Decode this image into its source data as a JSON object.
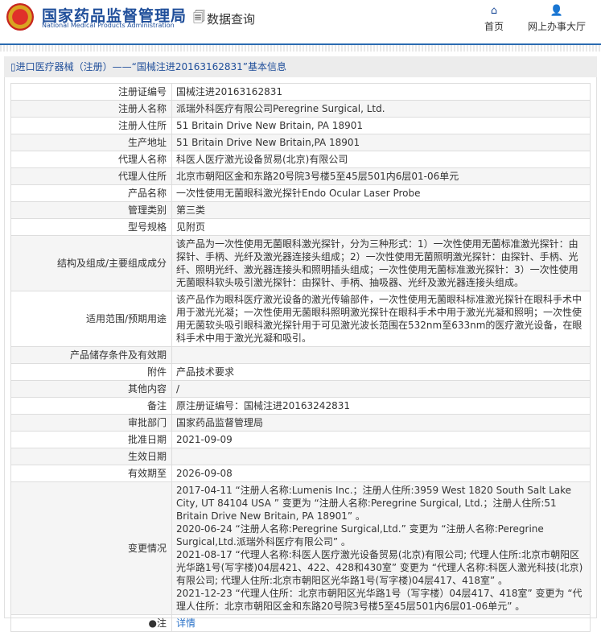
{
  "header": {
    "logo_cn": "国家药品监督管理局",
    "logo_en": "National Medical Products Administration",
    "data_query": "数据查询",
    "nav": [
      {
        "label": "首页",
        "icon": "home-icon"
      },
      {
        "label": "网上办事大厅",
        "icon": "user-icon"
      }
    ]
  },
  "breadcrumb": "进口医疗器械（注册）——“国械注进20163162831”基本信息",
  "rows": [
    {
      "label": "注册证编号",
      "value": "国械注进20163162831"
    },
    {
      "label": "注册人名称",
      "value": "派瑞外科医疗有限公司Peregrine Surgical, Ltd."
    },
    {
      "label": "注册人住所",
      "value": "51 Britain Drive New Britain, PA 18901"
    },
    {
      "label": "生产地址",
      "value": "51 Britain Drive New Britain,PA 18901"
    },
    {
      "label": "代理人名称",
      "value": "科医人医疗激光设备贸易(北京)有限公司"
    },
    {
      "label": "代理人住所",
      "value": "北京市朝阳区金和东路20号院3号楼5至45层501内6层01-06单元"
    },
    {
      "label": "产品名称",
      "value": "一次性使用无菌眼科激光探针Endo Ocular Laser Probe"
    },
    {
      "label": "管理类别",
      "value": "第三类"
    },
    {
      "label": "型号规格",
      "value": "见附页"
    },
    {
      "label": "结构及组成/主要组成成分",
      "value": "该产品为一次性使用无菌眼科激光探针，分为三种形式：1）一次性使用无菌标准激光探针：由探针、手柄、光纤及激光器连接头组成；2）一次性使用无菌照明激光探针：由探针、手柄、光纤、照明光纤、激光器连接头和照明插头组成；一次性使用无菌标准激光探针：3）一次性使用无菌眼科软头吸引激光探针：由探针、手柄、抽吸器、光纤及激光器连接头组成。"
    },
    {
      "label": "适用范围/预期用途",
      "value": "该产品作为眼科医疗激光设备的激光传输部件，一次性使用无菌眼科标准激光探针在眼科手术中用于激光光凝；一次性使用无菌眼科照明激光探针在眼科手术中用于激光光凝和照明；一次性使用无菌软头吸引眼科激光探针用于可见激光波长范围在532nm至633nm的医疗激光设备，在眼科手术中用于激光光凝和吸引。"
    },
    {
      "label": "产品储存条件及有效期",
      "value": ""
    },
    {
      "label": "附件",
      "value": "产品技术要求"
    },
    {
      "label": "其他内容",
      "value": "/"
    },
    {
      "label": "备注",
      "value": "原注册证编号：国械注进20163242831"
    },
    {
      "label": "审批部门",
      "value": "国家药品监督管理局"
    },
    {
      "label": "批准日期",
      "value": "2021-09-09"
    },
    {
      "label": "生效日期",
      "value": ""
    },
    {
      "label": "有效期至",
      "value": "2026-09-08"
    }
  ],
  "changes": {
    "label": "变更情况",
    "entries": [
      "2017-04-11 “注册人名称:Lumenis Inc.；注册人住所:3959 West 1820 South Salt Lake City, UT 84104 USA ” 变更为 “注册人名称:Peregrine Surgical, Ltd.；注册人住所:51 Britain Drive New Britain, PA 18901” 。",
      "2020-06-24 “注册人名称:Peregrine Surgical,Ltd.” 变更为 “注册人名称:Peregrine Surgical,Ltd.派瑞外科医疗有限公司” 。",
      "2021-08-17 “代理人名称:科医人医疗激光设备贸易(北京)有限公司; 代理人住所:北京市朝阳区光华路1号(写字楼)04层421、422、428和430室” 变更为 “代理人名称:科医人激光科技(北京)有限公司; 代理人住所:北京市朝阳区光华路1号(写字楼)04层417、418室” 。",
      "2021-12-23 “代理人住所：北京市朝阳区光华路1号（写字楼）04层417、418室” 变更为 “代理人住所：北京市朝阳区金和东路20号院3号楼5至45层501内6层01-06单元” 。"
    ]
  },
  "note": {
    "label": "注",
    "link": "详情"
  }
}
